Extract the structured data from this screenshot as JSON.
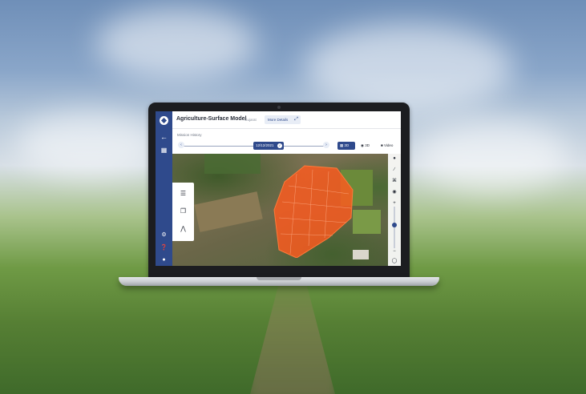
{
  "app": {
    "title": "Agriculture-Surface Model",
    "crumb": "Gujarat",
    "more_details_label": "More Details"
  },
  "mission": {
    "history_label": "Mission History",
    "date": "12/12/2021",
    "prev_icon": "chevron-left-icon",
    "next_icon": "chevron-right-icon"
  },
  "view_modes": {
    "two_d": "2D",
    "three_d": "3D",
    "video": "Video"
  },
  "sidebar": {
    "icons": [
      "logo-icon",
      "back-arrow-icon",
      "grid-icon",
      "settings-icon",
      "help-icon",
      "user-icon"
    ]
  },
  "map_tools": {
    "left": [
      "layers-icon",
      "copy-icon",
      "compass-icon"
    ],
    "right": [
      "pin-icon",
      "measure-icon",
      "crop-icon",
      "camera-icon",
      "zoom-in-icon",
      "zoom-out-icon",
      "locate-icon"
    ]
  },
  "colors": {
    "brand": "#2f4a8c",
    "overlay": "#ff5a1f"
  }
}
